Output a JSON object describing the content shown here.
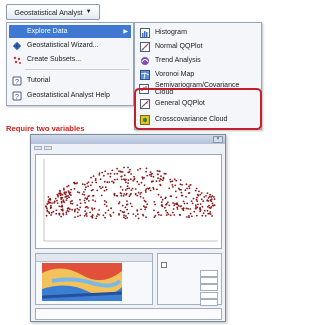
{
  "toolbar": {
    "title": "Geostatistical Analyst",
    "caret": "▼"
  },
  "menu_left": {
    "items": [
      {
        "label": "Explore Data",
        "icon": "blank",
        "highlighted": true,
        "submenu_arrow": "▶"
      },
      {
        "label": "Geostatistical Wizard...",
        "icon": "wizard-icon"
      },
      {
        "label": "Create Subsets...",
        "icon": "subsets-icon"
      },
      {
        "label": "Tutorial",
        "icon": "tutorial-icon"
      },
      {
        "label": "Geostatistical Analyst Help",
        "icon": "help-icon"
      }
    ]
  },
  "menu_right": {
    "items": [
      {
        "label": "Histogram",
        "icon": "histogram-icon"
      },
      {
        "label": "Normal QQPlot",
        "icon": "normal-qqplot-icon"
      },
      {
        "label": "Trend Analysis",
        "icon": "trend-analysis-icon"
      },
      {
        "label": "Voronoi Map",
        "icon": "voronoi-map-icon"
      },
      {
        "label": "Semivariogram/Covariance Cloud",
        "icon": "semivariogram-icon"
      },
      {
        "label": "General QQPlot",
        "icon": "general-qqplot-icon"
      },
      {
        "label": "Crosscovariance Cloud",
        "icon": "crosscovariance-icon"
      }
    ]
  },
  "annotation": {
    "text": "Require two variables",
    "color": "#d02020"
  },
  "colors": {
    "highlight": "#3f79d1",
    "redbox": "#c2202e",
    "points": "#8b1a1a"
  }
}
